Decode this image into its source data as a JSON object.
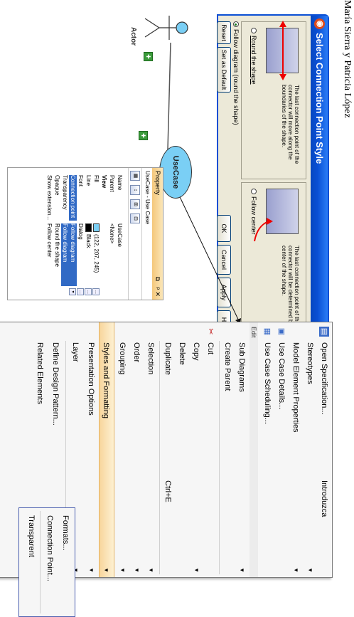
{
  "footer_text": "María Sierra y Patricia López",
  "dialog": {
    "title": "Select Connection Point Style",
    "round_desc": "The last connection point of the connector will move along the boundaries of the shape.",
    "center_desc": "The last connection point of the connector will be determined by the center of the shape.",
    "round_option": "Round the shape",
    "center_option": "Follow center",
    "follow_option": "Follow diagram (round the shape)",
    "buttons": {
      "reset": "Reset",
      "default": "Set as Default",
      "ok": "OK",
      "cancel": "Cancel",
      "apply": "Apply",
      "help": "Help"
    }
  },
  "diagram": {
    "actor_label": "Actor",
    "usecase_label": "UseCase"
  },
  "property": {
    "title": "Property",
    "subtitle": "UseCase - Use Case",
    "rows": [
      {
        "key": "Name",
        "value": "UseCase"
      },
      {
        "key": "Parent",
        "value": "<None>"
      },
      {
        "key": "View",
        "value": ""
      },
      {
        "key": "Fill",
        "value": "(122, 207, 245)"
      },
      {
        "key": "Line",
        "value": "Black"
      },
      {
        "key": "Font",
        "value": "Dialog"
      },
      {
        "key": "Connection point",
        "value": "Follow diagram"
      },
      {
        "key": "Transparency",
        "value": "Follow diagram"
      },
      {
        "key": "Opaque",
        "value": "Round the shape"
      },
      {
        "key": "Show extension...",
        "value": "Follow center"
      }
    ]
  },
  "menu": {
    "edit_header": "Edit",
    "items": [
      {
        "label": "Open Specification...",
        "shortcut": "Introduzca",
        "arrow": ""
      },
      {
        "label": "Stereotypes",
        "shortcut": "",
        "arrow": "▼"
      },
      {
        "label": "Model Element Properties",
        "shortcut": "",
        "arrow": "▼"
      },
      {
        "label": "Use Case Details...",
        "shortcut": "",
        "arrow": ""
      },
      {
        "label": "Use Case Scheduling...",
        "shortcut": "",
        "arrow": ""
      },
      {
        "label": "Sub Diagrams",
        "shortcut": "",
        "arrow": "▼"
      },
      {
        "label": "Create Parent",
        "shortcut": "",
        "arrow": ""
      },
      {
        "label": "Cut",
        "shortcut": "",
        "arrow": ""
      },
      {
        "label": "Copy",
        "shortcut": "",
        "arrow": "▼"
      },
      {
        "label": "Delete",
        "shortcut": "",
        "arrow": ""
      },
      {
        "label": "Duplicate",
        "shortcut": "Ctrl+E",
        "arrow": ""
      },
      {
        "label": "Selection",
        "shortcut": "",
        "arrow": "▼"
      },
      {
        "label": "Order",
        "shortcut": "",
        "arrow": "▼"
      },
      {
        "label": "Grouping",
        "shortcut": "",
        "arrow": "▼"
      },
      {
        "label": "Styles and Formatting",
        "shortcut": "",
        "arrow": "▼"
      },
      {
        "label": "Presentation Options",
        "shortcut": "",
        "arrow": "▼"
      },
      {
        "label": "Layer",
        "shortcut": "",
        "arrow": "▼"
      },
      {
        "label": "Define Design Pattern...",
        "shortcut": "",
        "arrow": ""
      },
      {
        "label": "Related Elements",
        "shortcut": "",
        "arrow": "▼"
      }
    ]
  },
  "submenu": {
    "items": [
      "Formats...",
      "Connection Point...",
      "Transparent"
    ]
  },
  "colors": {
    "usecase_fill": "#7acff5",
    "highlight": "#f8d69c",
    "selection": "#316ac5"
  }
}
